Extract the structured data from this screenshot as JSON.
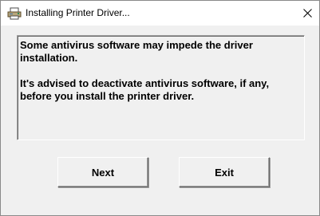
{
  "window": {
    "title": "Installing Printer Driver...",
    "icon": "printer-icon",
    "close_icon": "close-icon"
  },
  "message": {
    "line1": "Some antivirus software may impede the driver",
    "line2": "installation.",
    "line3": "It's advised to deactivate antivirus software, if any,",
    "line4": "before you install the printer driver."
  },
  "buttons": {
    "next_label": "Next",
    "exit_label": "Exit"
  }
}
